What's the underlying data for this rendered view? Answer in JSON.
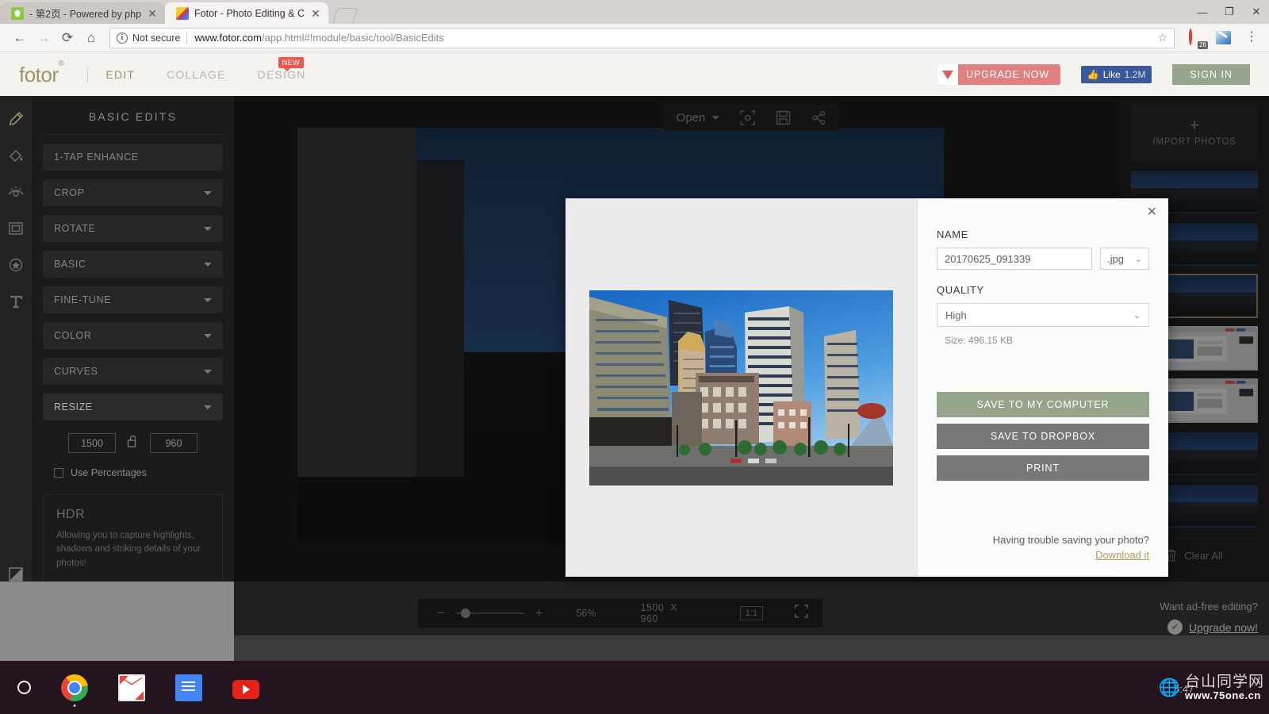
{
  "browser": {
    "tabs": [
      {
        "title": "- 第2页 - Powered by php",
        "favicon": "php-favicon",
        "active": false
      },
      {
        "title": "Fotor - Photo Editing & C",
        "favicon": "fotor-favicon",
        "active": true
      }
    ],
    "window_controls": {
      "minimize": "—",
      "maximize": "❐",
      "close": "✕"
    },
    "security_label": "Not secure",
    "security_icon": "info-circle-icon",
    "url_domain": "www.fotor.com",
    "url_path": "/app.html#!module/basic/tool/BasicEdits",
    "extension_badge_count": "26",
    "back_icon": "back-arrow-icon",
    "forward_icon": "forward-arrow-icon",
    "reload_icon": "reload-icon",
    "home_icon": "home-icon",
    "bookmark_icon": "star-icon",
    "menu_icon": "three-dots-icon"
  },
  "header": {
    "logo": "fotor",
    "logo_mark": "®",
    "nav": [
      {
        "label": "EDIT",
        "active": true
      },
      {
        "label": "COLLAGE",
        "active": false
      },
      {
        "label": "DESIGN",
        "active": false,
        "badge": "NEW"
      }
    ],
    "upgrade_label": "UPGRADE NOW",
    "facebook_like_label": "Like",
    "facebook_like_count": "1.2M",
    "signin_label": "SIGN IN"
  },
  "left_rail": [
    {
      "name": "pencil-icon",
      "active": true
    },
    {
      "name": "paint-bucket-icon",
      "active": false
    },
    {
      "name": "eye-icon",
      "active": false
    },
    {
      "name": "frame-icon",
      "active": false
    },
    {
      "name": "sticker-star-icon",
      "active": false
    },
    {
      "name": "text-icon",
      "active": false
    },
    {
      "name": "gradient-icon",
      "active": false
    },
    {
      "name": "draw-edit-icon",
      "active": false
    }
  ],
  "tool_panel": {
    "title": "BASIC EDITS",
    "tools": [
      {
        "label": "1-TAP ENHANCE",
        "caret": false
      },
      {
        "label": "CROP",
        "caret": true
      },
      {
        "label": "ROTATE",
        "caret": true
      },
      {
        "label": "BASIC",
        "caret": true
      },
      {
        "label": "FINE-TUNE",
        "caret": true
      },
      {
        "label": "COLOR",
        "caret": true
      },
      {
        "label": "CURVES",
        "caret": true
      },
      {
        "label": "RESIZE",
        "caret": true,
        "expanded": true
      }
    ],
    "resize": {
      "width": "1500",
      "height": "960",
      "lock_icon": "unlocked-padlock-icon",
      "use_percentages_label": "Use Percentages",
      "use_percentages_checked": false
    },
    "promo": {
      "title": "HDR",
      "body": "Allowing you to capture highlights, shadows and striking details of your photos!"
    }
  },
  "canvas": {
    "open_label": "Open",
    "toolbar_icons": [
      "crop-focus-icon",
      "save-floppy-icon",
      "share-icon"
    ],
    "zoom": {
      "minus": "−",
      "plus": "+",
      "percent": "56%",
      "width": "1500",
      "separator": "X",
      "height": "960",
      "ratio_label": "1:1",
      "fullscreen_icon": "fullscreen-icon",
      "slider_position_pct": 14
    }
  },
  "photos_panel": {
    "import_label": "IMPORT PHOTOS",
    "import_icon": "plus-icon",
    "collapse_icon": "chevron-right-icon",
    "clear_all_label": "Clear All",
    "trash_icon": "trash-icon",
    "thumbnails": [
      {
        "kind": "city",
        "selected": false
      },
      {
        "kind": "city",
        "selected": false
      },
      {
        "kind": "city",
        "selected": true
      },
      {
        "kind": "screenshot",
        "selected": false
      },
      {
        "kind": "screenshot",
        "selected": false
      },
      {
        "kind": "city",
        "selected": false
      },
      {
        "kind": "city",
        "selected": false
      }
    ]
  },
  "save_dialog": {
    "close_icon": "close-x-icon",
    "name_label": "NAME",
    "name_value": "20170625_091339",
    "extension_value": ".jpg",
    "quality_label": "QUALITY",
    "quality_value": "High",
    "size_text": "Size: 496.15 KB",
    "buttons": [
      {
        "label": "SAVE TO MY  COMPUTER",
        "style": "green"
      },
      {
        "label": "SAVE TO DROPBOX",
        "style": "grey"
      },
      {
        "label": "PRINT",
        "style": "grey"
      }
    ],
    "trouble_text": "Having trouble saving your photo?",
    "download_link": "Download it"
  },
  "ad_strip": {
    "question": "Want ad-free editing?",
    "link": "Upgrade now!",
    "icon": "check-badge-icon"
  },
  "taskbar": {
    "start_icon": "circle-start-icon",
    "apps": [
      {
        "name": "chrome-icon",
        "running": true
      },
      {
        "name": "gmail-icon",
        "running": false
      },
      {
        "name": "google-docs-icon",
        "running": false
      },
      {
        "name": "youtube-icon",
        "running": false
      }
    ],
    "clock": "5:47",
    "watermark_cn": "台山同学网",
    "watermark_url": "www.75one.cn",
    "watermark_brand": "ONE"
  },
  "colors": {
    "brand_gold": "#a09368",
    "accent_green": "#94a58b",
    "accent_red": "#e08080",
    "facebook_blue": "#3b5998",
    "link_gold": "#b59b57"
  }
}
